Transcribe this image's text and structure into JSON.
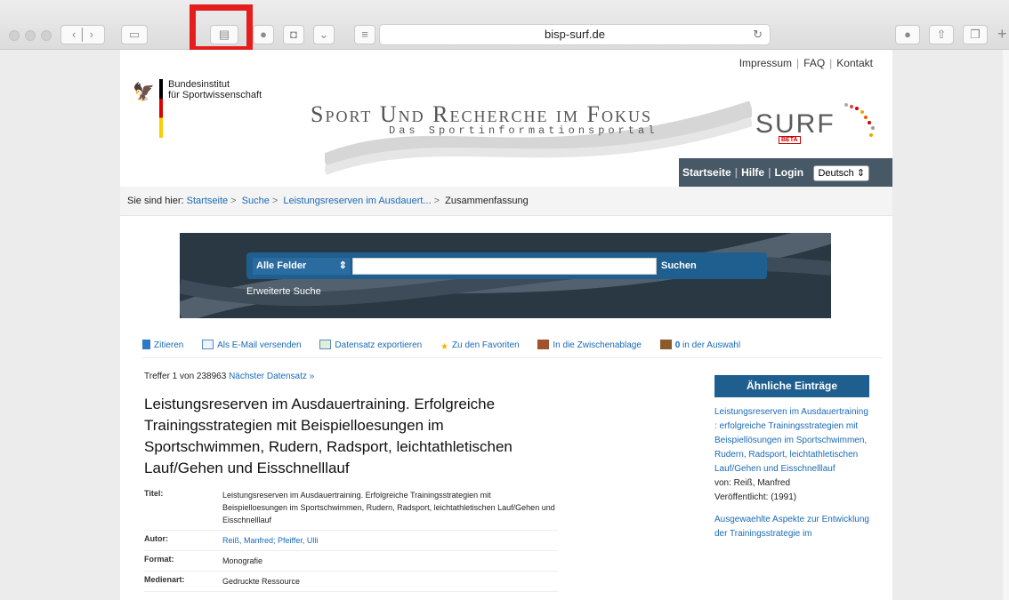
{
  "browser": {
    "url": "bisp-surf.de"
  },
  "header": {
    "institute_line1": "Bundesinstitut",
    "institute_line2": "für Sportwissenschaft",
    "toplinks": [
      "Impressum",
      "FAQ",
      "Kontakt"
    ],
    "hero_title": "Sport Und Recherche im Fokus",
    "hero_subtitle": "Das Sportinformationsportal",
    "logo_text": "SURF",
    "logo_badge": "BETA",
    "nav": {
      "start": "Startseite",
      "help": "Hilfe",
      "login": "Login",
      "language": "Deutsch"
    }
  },
  "breadcrumb": {
    "prefix": "Sie sind hier:",
    "items": [
      "Startseite",
      "Suche",
      "Leistungsreserven im Ausdauert...",
      "Zusammenfassung"
    ]
  },
  "search": {
    "field_select": "Alle Felder",
    "button": "Suchen",
    "advanced": "Erweiterte Suche"
  },
  "actions": [
    {
      "label": "Zitieren",
      "icon": "document-icon"
    },
    {
      "label": "Als E-Mail versenden",
      "icon": "mail-icon"
    },
    {
      "label": "Datensatz exportieren",
      "icon": "export-icon"
    },
    {
      "label": "Zu den Favoriten",
      "icon": "star-icon"
    },
    {
      "label": "In die Zwischenablage",
      "icon": "clipboard-icon"
    },
    {
      "label_count": "0",
      "label_rest": " in der Auswahl",
      "icon": "briefcase-icon"
    }
  ],
  "result": {
    "treffer_text": "Treffer 1 von 238963",
    "next_link": "Nächster Datensatz »",
    "title": "Leistungsreserven im Ausdauertraining. Erfolgreiche Trainingsstrategien mit Beispielloesungen im Sportschwimmen, Rudern, Radsport, leichtathletischen Lauf/Gehen und Eisschnelllauf",
    "meta": [
      {
        "label": "Titel:",
        "value": "Leistungsreserven im Ausdauertraining. Erfolgreiche Trainingsstrategien mit Beispielloesungen im Sportschwimmen, Rudern, Radsport, leichtathletischen Lauf/Gehen und Eisschnelllauf"
      },
      {
        "label": "Autor:",
        "value": "Reiß, Manfred; Pfeiffer, Ulli"
      },
      {
        "label": "Format:",
        "value": "Monografie"
      },
      {
        "label": "Medienart:",
        "value": "Gedruckte Ressource"
      }
    ]
  },
  "similar": {
    "heading": "Ähnliche Einträge",
    "entries": [
      {
        "title": "Leistungsreserven im Ausdauertraining : erfolgreiche Trainingsstrategien mit Beispiellösungen im Sportschwimmen, Rudern, Radsport, leichtathletischen Lauf/Gehen und Eisschnelllauf",
        "author": "von: Reiß, Manfred",
        "published": "Veröffentlicht: (1991)"
      },
      {
        "title": "Ausgewaehlte Aspekte zur Entwicklung der Trainingsstrategie im"
      }
    ]
  }
}
